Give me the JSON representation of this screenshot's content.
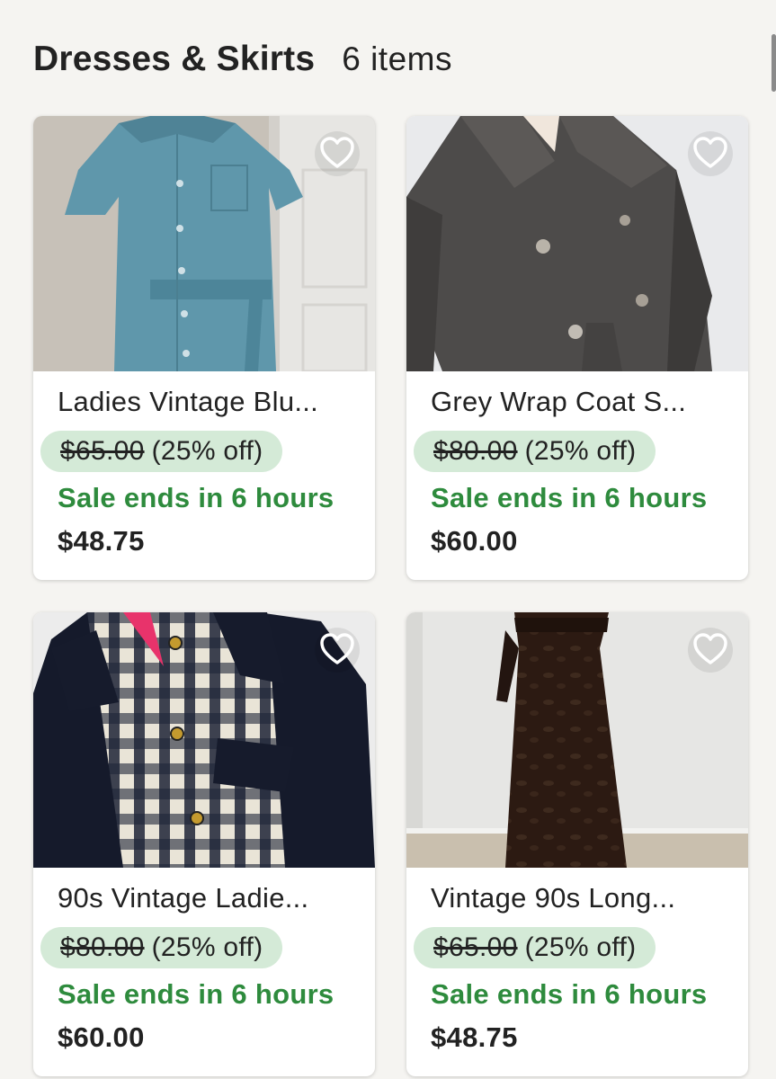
{
  "header": {
    "title": "Dresses & Skirts",
    "count": "6 items"
  },
  "icons": {
    "favorite": "heart-outline-icon"
  },
  "colors": {
    "sale_green": "#2e8b3d",
    "discount_bg": "#d4ead7"
  },
  "listings": [
    {
      "name": "Ladies Vintage Blu...",
      "original_price": "$65.00",
      "discount": "(25% off)",
      "sale_text": "Sale ends in 6 hours",
      "price": "$48.75"
    },
    {
      "name": "Grey Wrap Coat S...",
      "original_price": "$80.00",
      "discount": "(25% off)",
      "sale_text": "Sale ends in 6 hours",
      "price": "$60.00"
    },
    {
      "name": "90s Vintage Ladie...",
      "original_price": "$80.00",
      "discount": "(25% off)",
      "sale_text": "Sale ends in 6 hours",
      "price": "$60.00"
    },
    {
      "name": "Vintage 90s Long...",
      "original_price": "$65.00",
      "discount": "(25% off)",
      "sale_text": "Sale ends in 6 hours",
      "price": "$48.75"
    }
  ]
}
